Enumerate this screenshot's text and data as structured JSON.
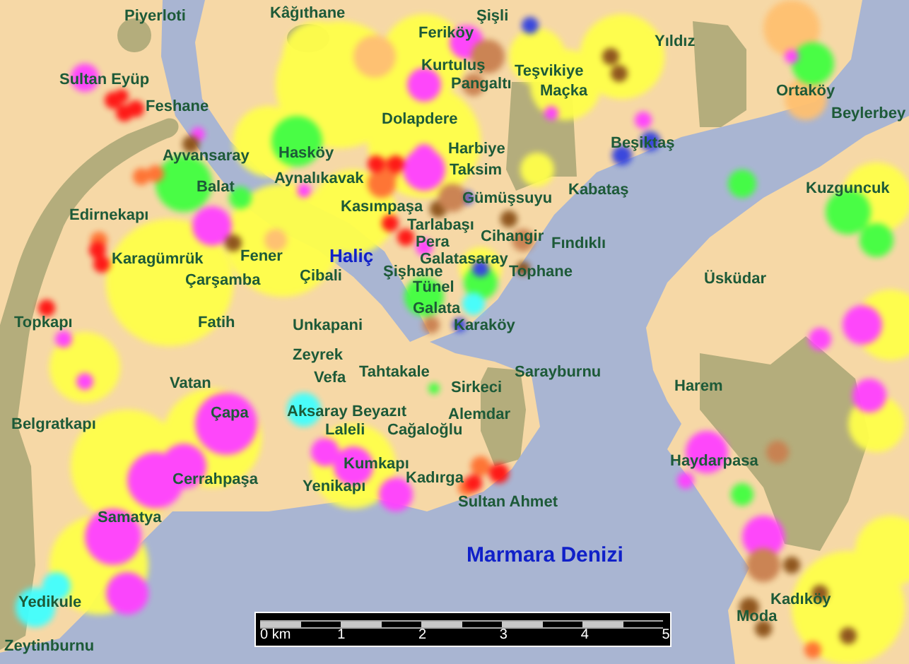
{
  "map": {
    "labels": [
      {
        "text": "Piyerloti",
        "kind": "district"
      },
      {
        "text": "Kâğıthane",
        "kind": "district"
      },
      {
        "text": "Şişli",
        "kind": "district"
      },
      {
        "text": "Feriköy",
        "kind": "district"
      },
      {
        "text": "Yıldız",
        "kind": "district"
      },
      {
        "text": "Sultan Eyüp",
        "kind": "district"
      },
      {
        "text": "Kurtuluş",
        "kind": "district"
      },
      {
        "text": "Teşvikiye",
        "kind": "district"
      },
      {
        "text": "Pangaltı",
        "kind": "district"
      },
      {
        "text": "Maçka",
        "kind": "district"
      },
      {
        "text": "Ortaköy",
        "kind": "district"
      },
      {
        "text": "Feshane",
        "kind": "district"
      },
      {
        "text": "Dolapdere",
        "kind": "district"
      },
      {
        "text": "Beylerbey",
        "kind": "district"
      },
      {
        "text": "Ayvansaray",
        "kind": "district"
      },
      {
        "text": "Hasköy",
        "kind": "district"
      },
      {
        "text": "Harbiye",
        "kind": "district"
      },
      {
        "text": "Beşiktaş",
        "kind": "district"
      },
      {
        "text": "Aynalıkavak",
        "kind": "district"
      },
      {
        "text": "Balat",
        "kind": "district"
      },
      {
        "text": "Taksim",
        "kind": "district"
      },
      {
        "text": "Kabataş",
        "kind": "district"
      },
      {
        "text": "Kuzguncuk",
        "kind": "district"
      },
      {
        "text": "Gümüşsuyu",
        "kind": "district"
      },
      {
        "text": "Kasımpaşa",
        "kind": "district"
      },
      {
        "text": "Edirnekapı",
        "kind": "district"
      },
      {
        "text": "Tarlabaşı",
        "kind": "district"
      },
      {
        "text": "Pera",
        "kind": "district"
      },
      {
        "text": "Cihangir",
        "kind": "district"
      },
      {
        "text": "Fındıklı",
        "kind": "district"
      },
      {
        "text": "Karagümrük",
        "kind": "district"
      },
      {
        "text": "Fener",
        "kind": "district"
      },
      {
        "text": "Haliç",
        "kind": "water"
      },
      {
        "text": "Galatasaray",
        "kind": "district"
      },
      {
        "text": "Çarşamba",
        "kind": "district"
      },
      {
        "text": "Çibali",
        "kind": "district"
      },
      {
        "text": "Şişhane",
        "kind": "district"
      },
      {
        "text": "Tophane",
        "kind": "district"
      },
      {
        "text": "Üsküdar",
        "kind": "district"
      },
      {
        "text": "Tünel",
        "kind": "district"
      },
      {
        "text": "Galata",
        "kind": "district"
      },
      {
        "text": "Topkapı",
        "kind": "district"
      },
      {
        "text": "Fatih",
        "kind": "district"
      },
      {
        "text": "Unkapani",
        "kind": "district"
      },
      {
        "text": "Karaköy",
        "kind": "district"
      },
      {
        "text": "Zeyrek",
        "kind": "district"
      },
      {
        "text": "Vatan",
        "kind": "district"
      },
      {
        "text": "Vefa",
        "kind": "district"
      },
      {
        "text": "Tahtakale",
        "kind": "district"
      },
      {
        "text": "Sirkeci",
        "kind": "district"
      },
      {
        "text": "Sarayburnu",
        "kind": "district"
      },
      {
        "text": "Harem",
        "kind": "district"
      },
      {
        "text": "Belgratkapı",
        "kind": "district"
      },
      {
        "text": "Çapa",
        "kind": "district"
      },
      {
        "text": "Aksaray",
        "kind": "district"
      },
      {
        "text": "Beyazıt",
        "kind": "district"
      },
      {
        "text": "Alemdar",
        "kind": "district"
      },
      {
        "text": "Laleli",
        "kind": "district"
      },
      {
        "text": "Cağaloğlu",
        "kind": "district"
      },
      {
        "text": "Kumkapı",
        "kind": "district"
      },
      {
        "text": "Haydarpasa",
        "kind": "district"
      },
      {
        "text": "Cerrahpaşa",
        "kind": "district"
      },
      {
        "text": "Yenikapı",
        "kind": "district"
      },
      {
        "text": "Kadırga",
        "kind": "district"
      },
      {
        "text": "Sultan Ahmet",
        "kind": "district"
      },
      {
        "text": "Samatya",
        "kind": "district"
      },
      {
        "text": "Marmara Denizi",
        "kind": "sea"
      },
      {
        "text": "Yedikule",
        "kind": "district"
      },
      {
        "text": "Kadıköy",
        "kind": "district"
      },
      {
        "text": "Moda",
        "kind": "district"
      },
      {
        "text": "Zeytinburnu",
        "kind": "district"
      }
    ],
    "scale_bar": {
      "labels": [
        "0 km",
        "1",
        "2",
        "3",
        "4",
        "5"
      ]
    }
  }
}
